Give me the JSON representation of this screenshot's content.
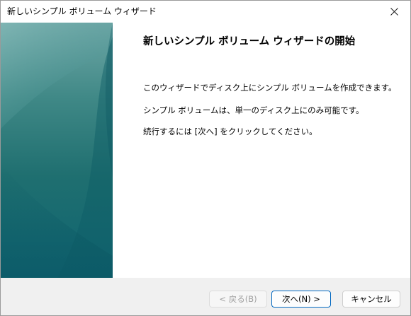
{
  "window": {
    "title": "新しいシンプル ボリューム ウィザード"
  },
  "content": {
    "heading": "新しいシンプル ボリューム ウィザードの開始",
    "paragraphs": [
      "このウィザードでディスク上にシンプル ボリュームを作成できます。",
      "シンプル ボリュームは、単一のディスク上にのみ可能です。",
      "続行するには [次へ] をクリックしてください。"
    ]
  },
  "buttons": {
    "back": {
      "label": "< 戻る(B)",
      "enabled": false
    },
    "next": {
      "label": "次へ(N) >",
      "enabled": true
    },
    "cancel": {
      "label": "キャンセル",
      "enabled": true
    }
  },
  "colors": {
    "side_panel_top": "#6fa7a6",
    "side_panel_bottom": "#0f6471",
    "default_button_border": "#0067c0",
    "footer_background": "#f0f0f0"
  },
  "icons": {
    "close": "close-icon"
  }
}
